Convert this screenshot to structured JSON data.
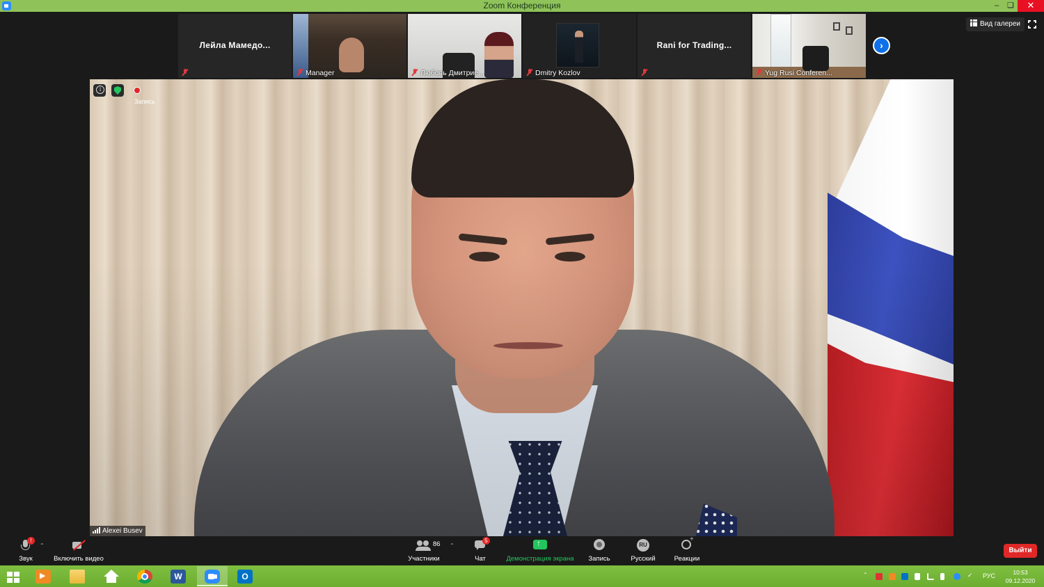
{
  "window": {
    "title": "Zoom Конференция",
    "minimize_icon": "minimize-icon",
    "restore_icon": "restore-icon",
    "close_icon": "close-icon"
  },
  "gallery": {
    "tiles": [
      {
        "name": "Лейла  Мамедо...",
        "caption": "",
        "has_video": false,
        "muted": true
      },
      {
        "name": "Manager",
        "caption": "Manager",
        "has_video": true,
        "muted": true
      },
      {
        "name": "Любовь Дмитрие...",
        "caption": "Любовь Дмитрие...",
        "has_video": true,
        "muted": true
      },
      {
        "name": "Dmitry Kozlov",
        "caption": "Dmitry Kozlov",
        "has_video": true,
        "muted": true
      },
      {
        "name": "Rani for Trading...",
        "caption": "",
        "has_video": false,
        "muted": true
      },
      {
        "name": "Yug Rusi Conferen...",
        "caption": "Yug Rusi Conferen...",
        "has_video": true,
        "muted": true
      }
    ],
    "next_page_icon": "chevron-right-icon",
    "view_button_label": "Вид галереи",
    "fullscreen_icon": "fullscreen-icon"
  },
  "main_video": {
    "recording_label": "Запись",
    "speaker_name": "Alexei Busev"
  },
  "toolbar": {
    "audio": {
      "label": "Звук",
      "badge": "!"
    },
    "video": {
      "label": "Включить видео"
    },
    "participants": {
      "label": "Участники",
      "count": "86"
    },
    "chat": {
      "label": "Чат",
      "badge": "5"
    },
    "share": {
      "label": "Демонстрация экрана"
    },
    "record": {
      "label": "Запись"
    },
    "language": {
      "label": "Русский",
      "code": "RU"
    },
    "reactions": {
      "label": "Реакции"
    },
    "leave": {
      "label": "Выйти"
    }
  },
  "taskbar": {
    "apps": [
      "windows-start",
      "media-player",
      "file-explorer",
      "home",
      "chrome",
      "word",
      "zoom",
      "outlook"
    ],
    "active_app": "zoom",
    "word_letter": "W",
    "outlook_letter": "O",
    "tray": {
      "language": "РУС",
      "time": "10:53",
      "date": "09.12.2020"
    }
  },
  "colors": {
    "titlebar": "#8fc35a",
    "taskbar": "#7fbf40",
    "zoom_blue": "#0e71eb",
    "share_green": "#23c55e",
    "leave_red": "#e02828",
    "muted_red": "#e0383e"
  }
}
